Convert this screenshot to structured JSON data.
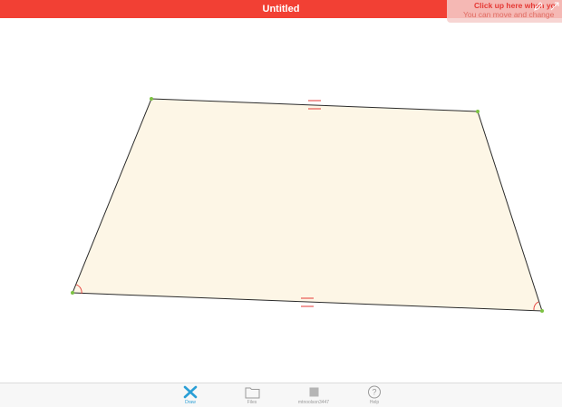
{
  "header": {
    "title": "Untitled"
  },
  "hint": {
    "line1": "Click up here when yo",
    "line2": "You can move and change"
  },
  "tabs": [
    {
      "label": "Draw",
      "icon": "draw-tool-icon",
      "active": true
    },
    {
      "label": "Files",
      "icon": "folder-icon",
      "active": false
    },
    {
      "label": "mtnoolson3447",
      "icon": "account-square-icon",
      "active": false
    },
    {
      "label": "Help",
      "icon": "help-circle-icon",
      "active": false
    }
  ],
  "colors": {
    "header_bg": "#f24034",
    "shape_fill": "#fdf6e6",
    "shape_stroke": "#2b2b2b",
    "vertex_dot": "#7cc242",
    "angle_arc": "#e53935",
    "tab_active": "#2a9fd6",
    "tab_inactive": "#9a9a9a"
  }
}
